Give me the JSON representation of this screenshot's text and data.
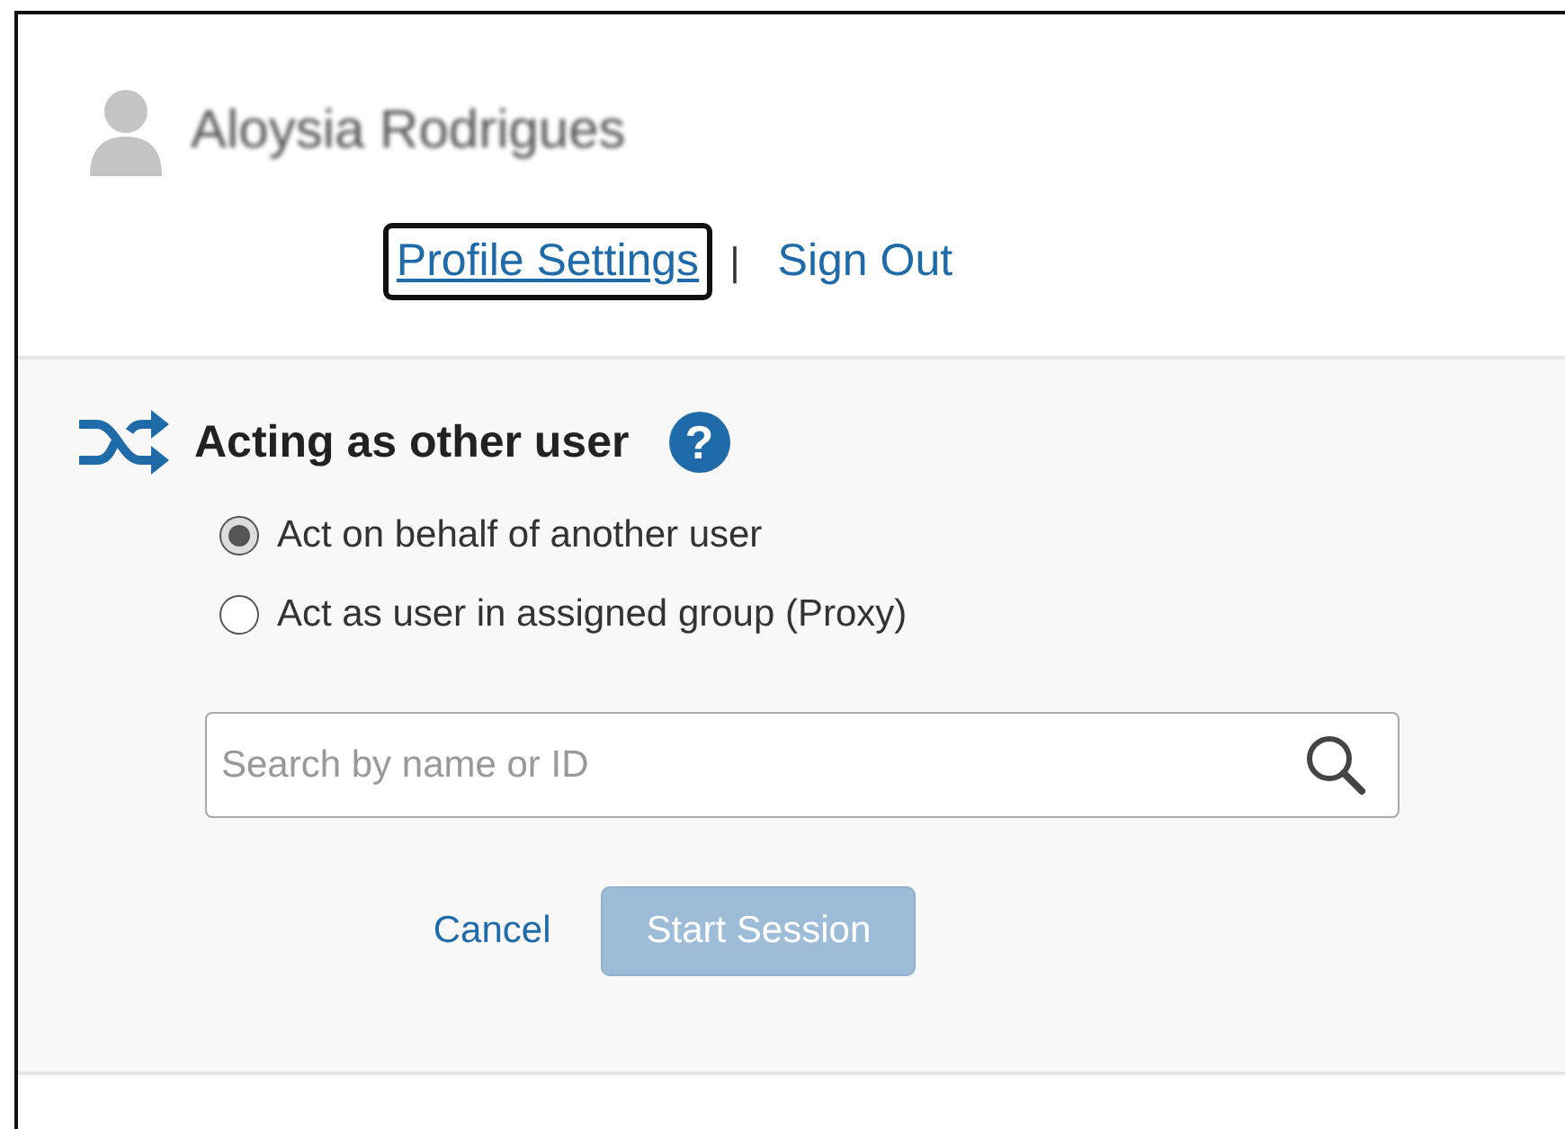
{
  "user": {
    "name": "Aloysia Rodrigues"
  },
  "links": [
    {
      "label": "Profile Settings",
      "focused": true
    },
    {
      "label": "Sign Out",
      "focused": false
    }
  ],
  "separator": "|",
  "section": {
    "title": "Acting as other user",
    "help": "?"
  },
  "options": [
    {
      "label": "Act on behalf of another user",
      "selected": true
    },
    {
      "label": "Act as user in assigned group (Proxy)",
      "selected": false
    }
  ],
  "search": {
    "placeholder": "Search by name or ID"
  },
  "buttons": [
    {
      "label": "Cancel",
      "kind": "link",
      "disabled": false
    },
    {
      "label": "Start Session",
      "kind": "primary",
      "disabled": true
    }
  ]
}
